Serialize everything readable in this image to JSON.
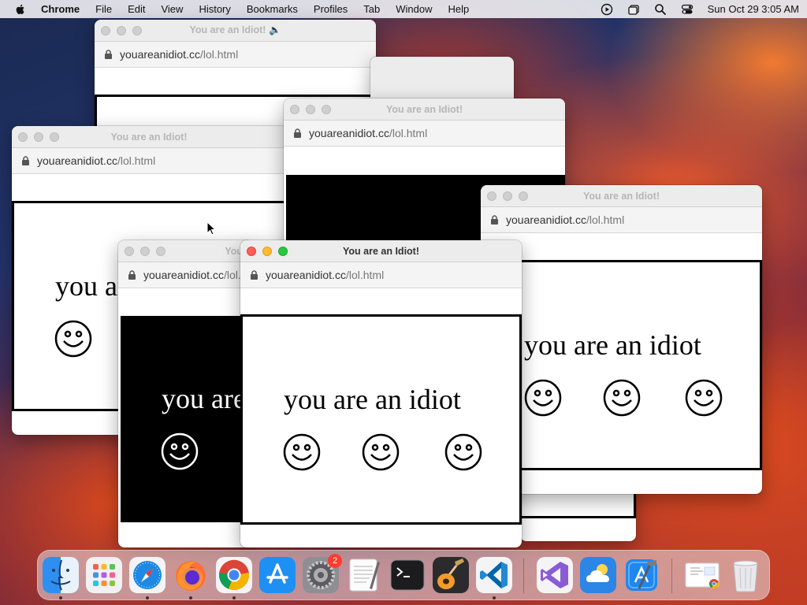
{
  "menubar": {
    "app_name": "Chrome",
    "items": [
      "File",
      "Edit",
      "View",
      "History",
      "Bookmarks",
      "Profiles",
      "Tab",
      "Window",
      "Help"
    ],
    "clock": "Sun Oct 29  3:05 AM"
  },
  "windows": {
    "w1": {
      "title": "You are an Idiot! 🔈",
      "url_domain": "youareanidiot.cc",
      "url_path": "/lol.html"
    },
    "w3": {
      "title": "You are an Idiot!",
      "url_domain": "youareanidiot.cc",
      "url_path": "/lol.html",
      "text": "you are an idiot"
    },
    "w4": {
      "title": "You are an Idiot!",
      "url_domain": "youareanidiot.cc",
      "url_path": "/lol.html"
    },
    "w5": {
      "title": "You are an Idiot!",
      "url_domain": "youareanidiot.cc",
      "url_path": "/lol.html",
      "text": "you are an idiot"
    },
    "w6": {
      "title": "You",
      "url_domain": "youareanidiot.cc",
      "url_path": "/lol.html",
      "text": "you are an idiot"
    },
    "w7": {
      "title": "You are an Idiot!",
      "url_domain": "youareanidiot.cc",
      "url_path": "/lol.html",
      "text": "you are an idiot"
    }
  },
  "dock": {
    "apps": [
      "finder-icon",
      "launchpad-icon",
      "safari-icon",
      "firefox-icon",
      "chrome-icon",
      "app-store-icon",
      "system-settings-icon",
      "textedit-icon",
      "terminal-icon",
      "garageband-icon",
      "vscode-icon",
      "visual-studio-icon",
      "weather-icon",
      "xcode-icon",
      "preview-document-icon",
      "trash-icon"
    ],
    "settings_badge": "2"
  },
  "colors": {
    "close": "#ff5f57",
    "minimize": "#febc2e",
    "maximize": "#28c840",
    "badge": "#ff3b30"
  }
}
